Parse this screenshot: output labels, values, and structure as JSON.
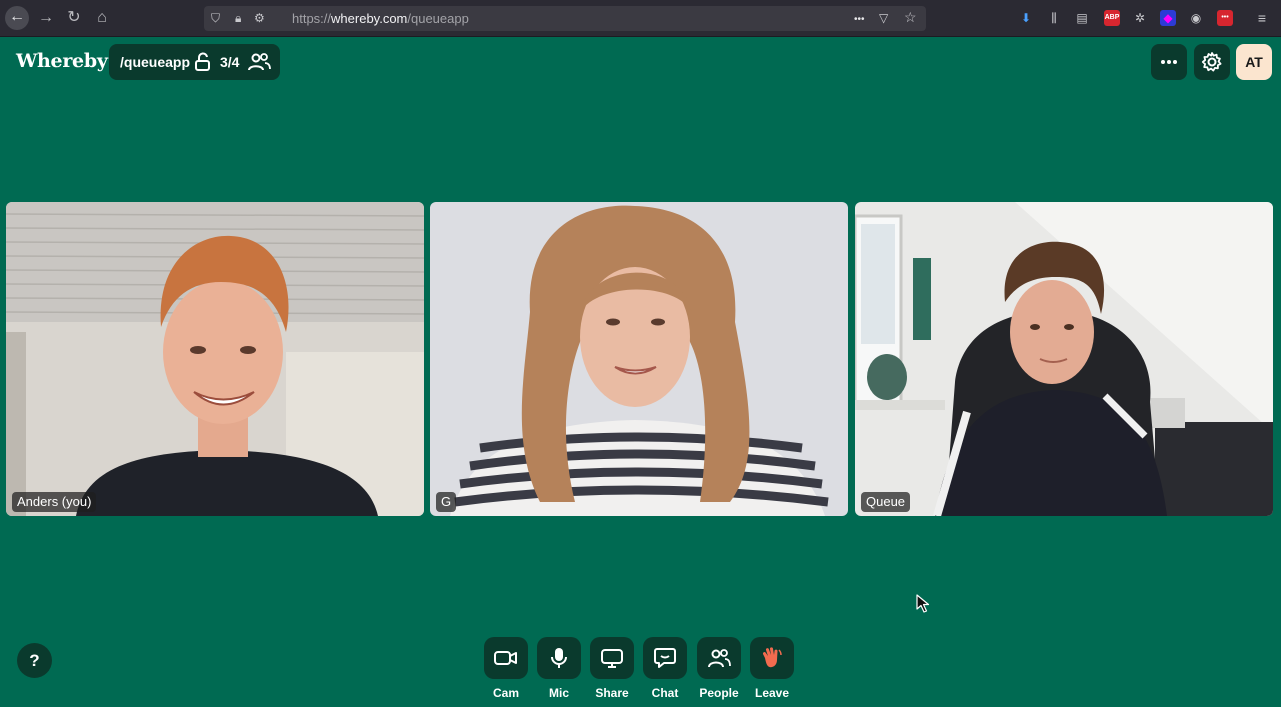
{
  "browser": {
    "url_prefix": "https://",
    "url_host": "whereby.com",
    "url_path": "/queueapp",
    "overflow_label": "•••"
  },
  "app": {
    "logo": "Whereby",
    "room_name": "/queueapp",
    "participant_count": "3/4",
    "avatar_initials": "AT"
  },
  "participants": [
    {
      "name": "Anders (you)"
    },
    {
      "name": "G"
    },
    {
      "name": "Queue"
    }
  ],
  "controls": {
    "help": "?",
    "cam": "Cam",
    "mic": "Mic",
    "share": "Share",
    "chat": "Chat",
    "people": "People",
    "leave": "Leave"
  },
  "colors": {
    "background": "#006a52",
    "button_bg": "#0a3a2d",
    "leave_accent": "#f26b4f",
    "avatar_bg": "#fbe5cf"
  }
}
